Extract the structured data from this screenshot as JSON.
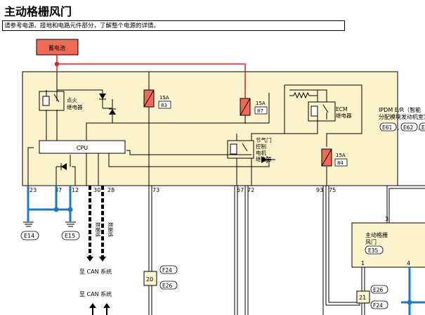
{
  "page": {
    "title": "主动格栅风门",
    "note": "请参考电源、接地和电路元件部分，了解整个电源的详情。"
  },
  "diagram": {
    "battery_label": "蓄电池",
    "ignition_relay_label": [
      "点火",
      "继电器"
    ],
    "cpu_label": "CPU",
    "fuse_1": {
      "rating": "15A",
      "number": "83"
    },
    "fuse_2": {
      "rating": "15A",
      "number": "87"
    },
    "fuse_3": {
      "rating": "15A",
      "number": "84"
    },
    "ecm_relay_label": [
      "ECM",
      "继电器"
    ],
    "throttle_relay_label": [
      "节气门",
      "控制",
      "电机",
      "继电器"
    ],
    "ipdm_label": [
      "IPDM E/R（智能",
      "分配模块发动机室）"
    ],
    "ipdm_connectors": [
      "E61",
      "E62",
      "E6"
    ],
    "pins": [
      "23",
      "37",
      "12",
      "30",
      "28",
      "73",
      "67",
      "72",
      "93",
      "75"
    ],
    "ground_1": "E14",
    "ground_2": "E15",
    "data_line_label": "数据线",
    "can_label_1": "至 CAN 系统",
    "can_label_2": "至 CAN 系统",
    "connector_20": {
      "number": "20",
      "top": "F24",
      "bottom": "E26"
    },
    "connector_21": {
      "number": "21",
      "top": "E26",
      "bottom": "F24"
    },
    "shutter_label": [
      "主动格栅",
      "风门"
    ],
    "shutter_connector": "E35",
    "shutter_pins": [
      "3",
      "1",
      "4"
    ]
  }
}
